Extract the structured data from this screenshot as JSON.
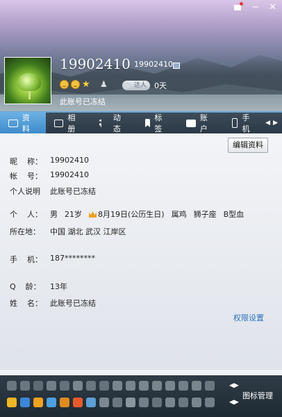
{
  "window": {
    "skin_icon": "skin-icon",
    "close_label": "✕",
    "minimize_label": "−"
  },
  "profile": {
    "name": "19902410",
    "qq_number": "19902410",
    "level_label": "达人",
    "days": "0天",
    "signature": "此账号已冻结"
  },
  "tabs": [
    {
      "label": "资料",
      "icon": "id-card-icon"
    },
    {
      "label": "相册",
      "icon": "photo-icon"
    },
    {
      "label": "动态",
      "icon": "list-icon"
    },
    {
      "label": "标签",
      "icon": "bookmark-icon"
    },
    {
      "label": "账户",
      "icon": "briefcase-icon"
    },
    {
      "label": "手机",
      "icon": "phone-icon"
    }
  ],
  "edit_button": "编辑资料",
  "info": {
    "nickname_label": "昵    称：",
    "nickname": "19902410",
    "account_label": "帐    号：",
    "account": "19902410",
    "bio_label": "个人说明",
    "bio": "此账号已冻结",
    "personal_label": "个    人：",
    "gender": "男",
    "age": "21岁",
    "birthday": "8月19日(公历生日)",
    "zodiac": "属鸡",
    "constellation": "狮子座",
    "blood": "B型血",
    "location_label": "所在地：",
    "location": "中国 湖北 武汉 江岸区",
    "phone_label": "手    机：",
    "phone": "187********",
    "qage_label": "Q    龄：",
    "qage": "13年",
    "realname_label": "姓    名：",
    "realname": "此账号已冻结"
  },
  "permission_link": "权限设置",
  "icon_management": "图标管理"
}
